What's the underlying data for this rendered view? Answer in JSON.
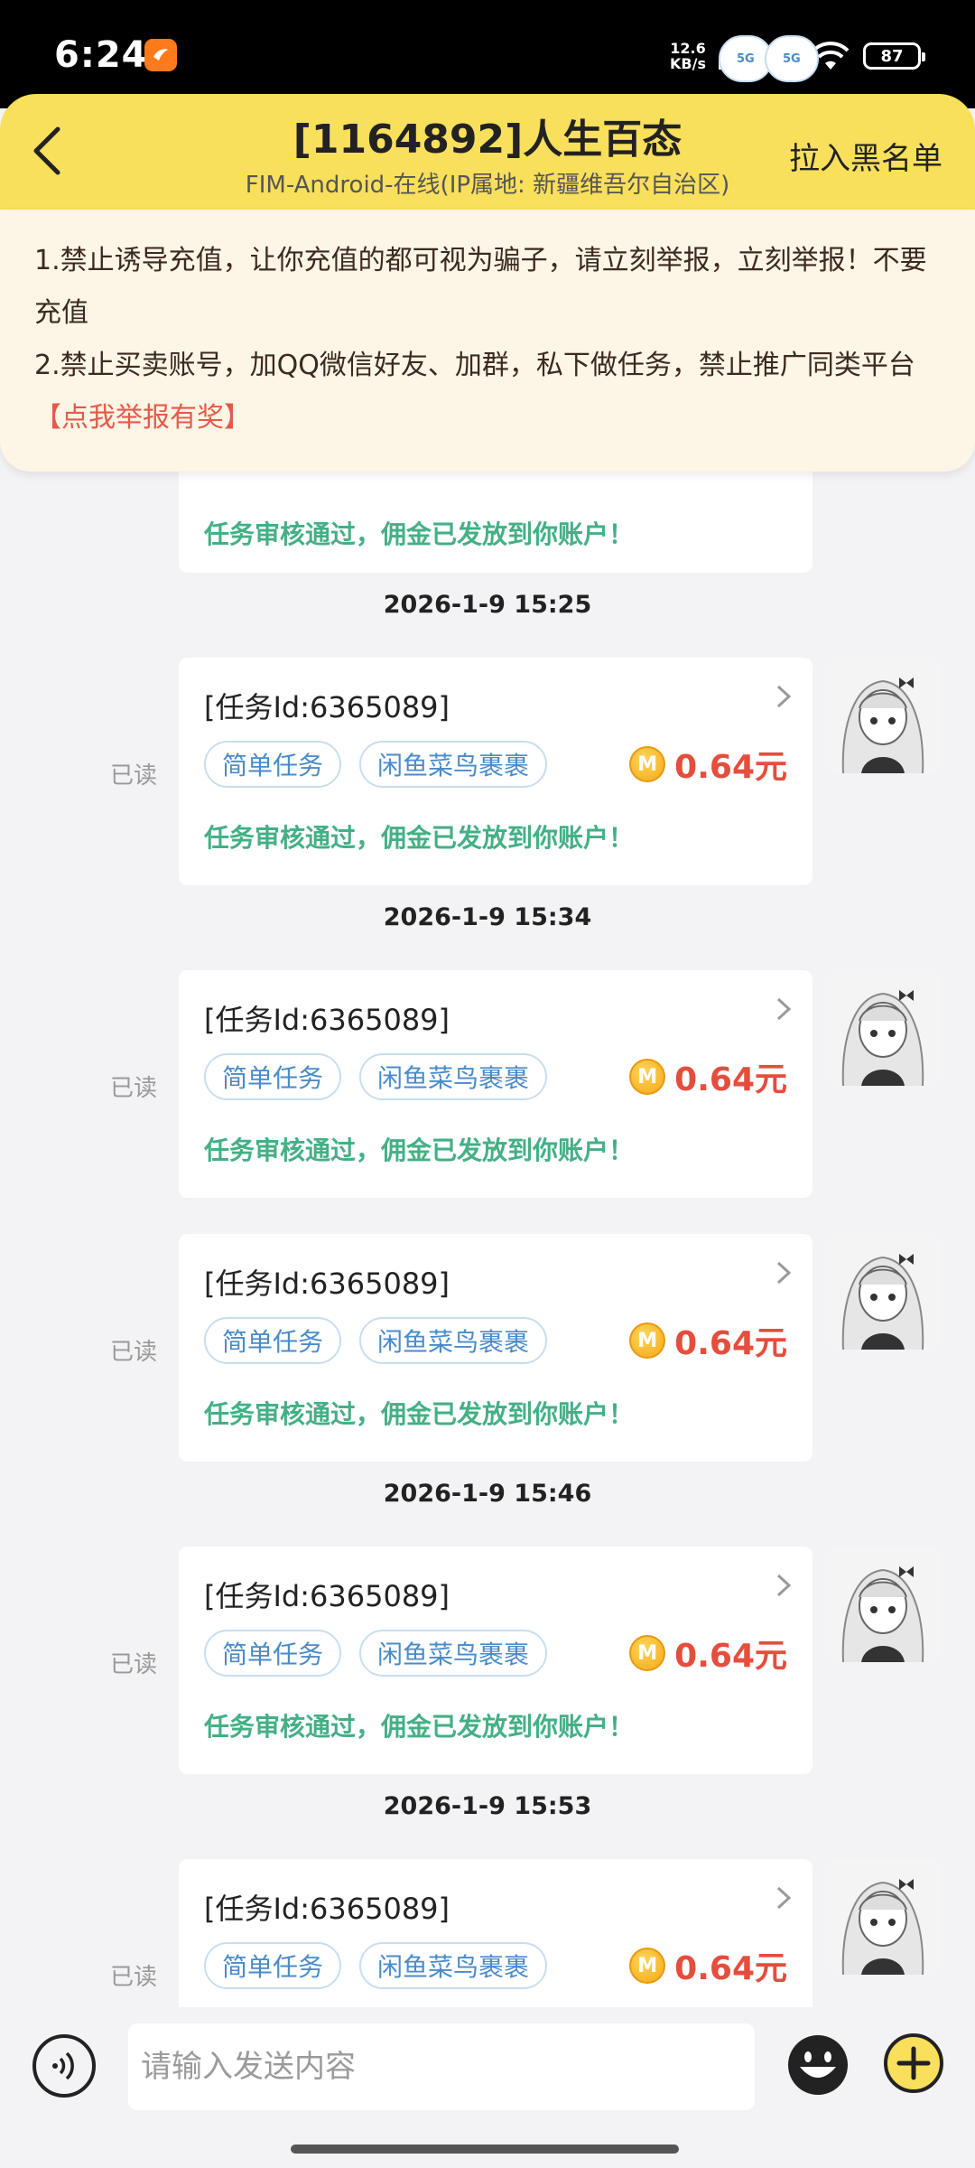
{
  "status_bar": {
    "time": "6:24",
    "net_speed_value": "12.6",
    "net_speed_unit": "KB/s",
    "net_type_1": "5G",
    "net_type_2": "5G",
    "battery": "87"
  },
  "header": {
    "title": "[1164892]人生百态",
    "subtitle": "FIM-Android-在线(IP属地: 新疆维吾尔自治区)",
    "blacklist_label": "拉入黑名单"
  },
  "notice": {
    "line1": "1.禁止诱导充值，让你充值的都可视为骗子，请立刻举报，立刻举报！不要充值",
    "line2": "2.禁止买卖账号，加QQ微信好友、加群，私下做任务，禁止推广同类平台",
    "report_link": "【点我举报有奖】"
  },
  "messages": [
    {
      "status_msg": "任务审核通过，佣金已发放到你账户！"
    },
    {
      "timestamp": "2026-1-9 15:25",
      "read_label": "已读",
      "task_id": "[任务Id:6365089]",
      "tag1": "简单任务",
      "tag2": "闲鱼菜鸟裹裹",
      "coin": "M",
      "amount": "0.64元",
      "status_msg": "任务审核通过，佣金已发放到你账户！"
    },
    {
      "timestamp": "2026-1-9 15:34",
      "read_label": "已读",
      "task_id": "[任务Id:6365089]",
      "tag1": "简单任务",
      "tag2": "闲鱼菜鸟裹裹",
      "coin": "M",
      "amount": "0.64元",
      "status_msg": "任务审核通过，佣金已发放到你账户！"
    },
    {
      "read_label": "已读",
      "task_id": "[任务Id:6365089]",
      "tag1": "简单任务",
      "tag2": "闲鱼菜鸟裹裹",
      "coin": "M",
      "amount": "0.64元",
      "status_msg": "任务审核通过，佣金已发放到你账户！"
    },
    {
      "timestamp": "2026-1-9 15:46",
      "read_label": "已读",
      "task_id": "[任务Id:6365089]",
      "tag1": "简单任务",
      "tag2": "闲鱼菜鸟裹裹",
      "coin": "M",
      "amount": "0.64元",
      "status_msg": "任务审核通过，佣金已发放到你账户！"
    },
    {
      "timestamp": "2026-1-9 15:53",
      "read_label": "已读",
      "task_id": "[任务Id:6365089]",
      "tag1": "简单任务",
      "tag2": "闲鱼菜鸟裹裹",
      "coin": "M",
      "amount": "0.64元"
    }
  ],
  "input_bar": {
    "placeholder": "请输入发送内容"
  },
  "colors": {
    "header_bg": "#f8df5c",
    "notice_bg": "#fdf5e6",
    "amount": "#e54d3d",
    "status_green": "#43b085",
    "tag_blue": "#4a8bc9"
  }
}
